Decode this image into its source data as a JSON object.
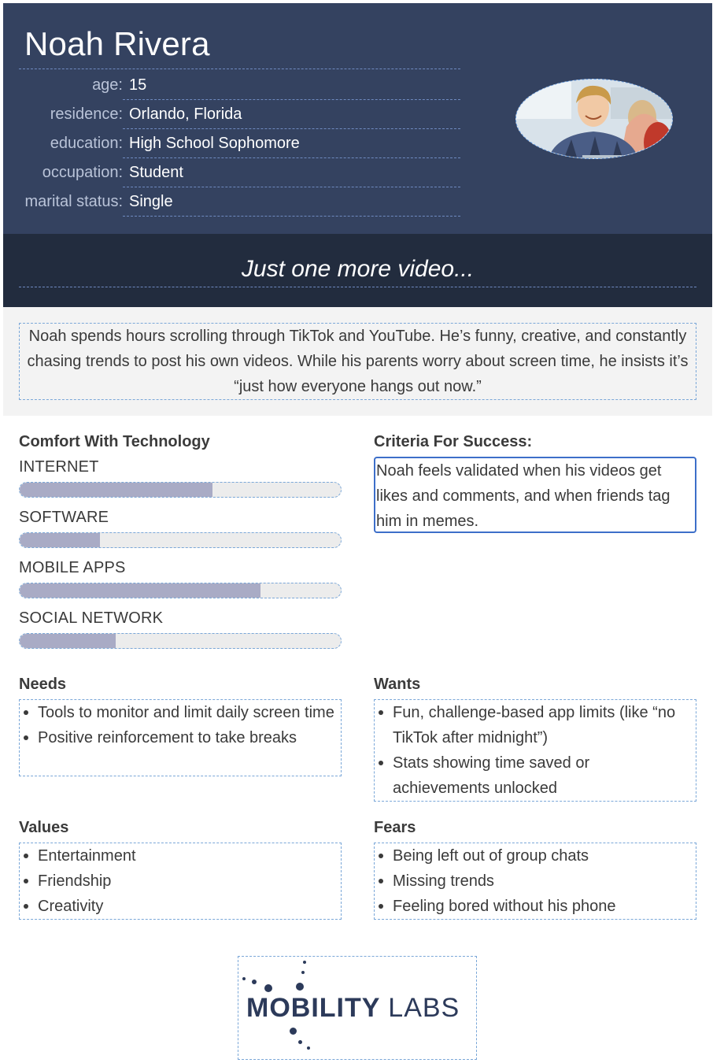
{
  "persona": {
    "name": "Noah Rivera",
    "facts": [
      {
        "label": "age:",
        "value": "15"
      },
      {
        "label": "residence:",
        "value": "Orlando, Florida"
      },
      {
        "label": "education:",
        "value": "High School Sophomore"
      },
      {
        "label": "occupation:",
        "value": "Student"
      },
      {
        "label": "marital status:",
        "value": "Single"
      }
    ],
    "photo_alt": "Noah Rivera portrait photo",
    "tagline": "Just one more video...",
    "bio": "Noah spends hours scrolling through TikTok and YouTube. He’s funny, creative, and constantly chasing trends to post his own videos. While his parents worry about screen time, he insists it’s “just how everyone hangs out now.”"
  },
  "comfort": {
    "title": "Comfort With Technology",
    "skills": [
      {
        "label": "INTERNET",
        "level": 0.6
      },
      {
        "label": "SOFTWARE",
        "level": 0.25
      },
      {
        "label": "MOBILE APPS",
        "level": 0.75
      },
      {
        "label": "SOCIAL NETWORK",
        "level": 0.3
      }
    ]
  },
  "criteria": {
    "title": "Criteria For Success:",
    "text": "Noah feels validated when his videos get likes and comments, and when friends tag him in memes."
  },
  "needs": {
    "title": "Needs",
    "items": [
      "Tools to monitor and limit daily screen time",
      "Positive reinforcement to take breaks"
    ]
  },
  "wants": {
    "title": "Wants",
    "items": [
      "Fun, challenge-based app limits (like “no TikTok after midnight”)",
      "Stats showing time saved or achievements unlocked"
    ]
  },
  "values": {
    "title": "Values",
    "items": [
      "Entertainment",
      "Friendship",
      "Creativity"
    ]
  },
  "fears": {
    "title": "Fears",
    "items": [
      "Being left out of group chats",
      "Missing trends",
      "Feeling bored without his phone"
    ]
  },
  "logo": {
    "bold": "MOBILITY",
    "light": "LABS"
  },
  "colors": {
    "header_bg": "#344260",
    "tagline_bg": "#222c3e",
    "bar_fill": "#a9abc5",
    "accent_border": "#3d6fc9"
  }
}
